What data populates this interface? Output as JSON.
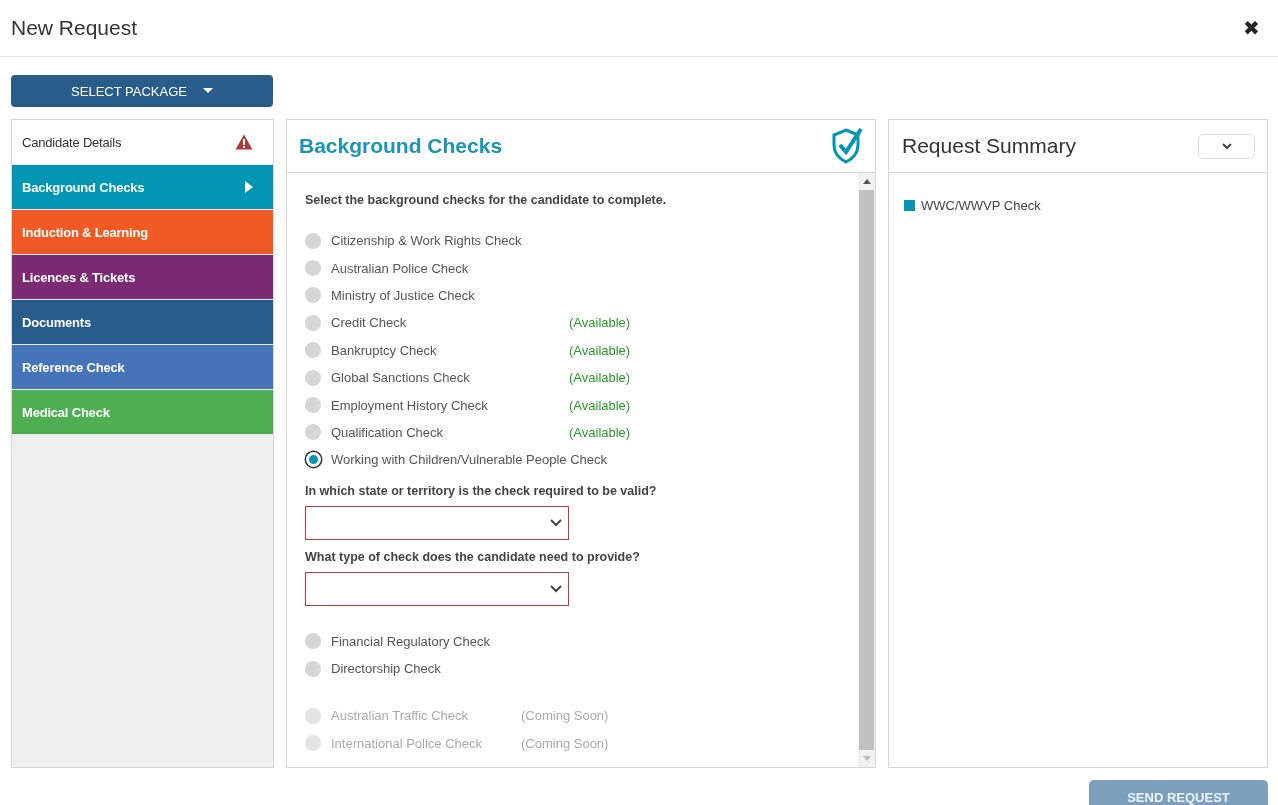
{
  "dialog": {
    "title": "New Request",
    "close": "✖"
  },
  "package_button": {
    "label": "SELECT PACKAGE"
  },
  "sidebar": {
    "items": [
      {
        "label": "Candidate Details",
        "color": "#ffffff",
        "selected": false,
        "warning": true
      },
      {
        "label": "Background Checks",
        "color": "#0096b4",
        "selected": true,
        "warning": false
      },
      {
        "label": "Induction & Learning",
        "color": "#f15a24",
        "selected": false,
        "warning": false
      },
      {
        "label": "Licences & Tickets",
        "color": "#7b2b74",
        "selected": false,
        "warning": false
      },
      {
        "label": "Documents",
        "color": "#285c8a",
        "selected": false,
        "warning": false
      },
      {
        "label": "Reference Check",
        "color": "#4575b8",
        "selected": false,
        "warning": false
      },
      {
        "label": "Medical Check",
        "color": "#4fae52",
        "selected": false,
        "warning": false
      }
    ]
  },
  "checks_panel": {
    "title": "Background Checks",
    "intro": "Select the background checks for the candidate to complete.",
    "sections": [
      {
        "kind": "options",
        "items": [
          {
            "label": "Citizenship & Work Rights Check",
            "selected": false,
            "disabled": false
          },
          {
            "label": "Australian Police Check",
            "selected": false,
            "disabled": false
          },
          {
            "label": "Ministry of Justice Check",
            "selected": false,
            "disabled": false
          },
          {
            "label": "Credit Check",
            "selected": false,
            "disabled": false,
            "status": "(Available)"
          },
          {
            "label": "Bankruptcy Check",
            "selected": false,
            "disabled": false,
            "status": "(Available)"
          },
          {
            "label": "Global Sanctions Check",
            "selected": false,
            "disabled": false,
            "status": "(Available)"
          },
          {
            "label": "Employment History Check",
            "selected": false,
            "disabled": false,
            "status": "(Available)"
          },
          {
            "label": "Qualification Check",
            "selected": false,
            "disabled": false,
            "status": "(Available)"
          },
          {
            "label": "Working with Children/Vulnerable People Check",
            "selected": true,
            "disabled": false
          }
        ]
      },
      {
        "kind": "question",
        "label": "In which state or territory is the check required to be valid?",
        "invalid": true
      },
      {
        "kind": "question",
        "label": "What type of check does the candidate need to provide?",
        "invalid": true
      },
      {
        "kind": "options",
        "items": [
          {
            "label": "Financial Regulatory Check",
            "selected": false,
            "disabled": false
          },
          {
            "label": "Directorship Check",
            "selected": false,
            "disabled": false
          }
        ]
      },
      {
        "kind": "options",
        "items": [
          {
            "label": "Australian Traffic Check",
            "selected": false,
            "disabled": true,
            "status": "(Coming Soon)"
          },
          {
            "label": "International Police Check",
            "selected": false,
            "disabled": true,
            "status": "(Coming Soon)"
          }
        ]
      }
    ]
  },
  "summary_panel": {
    "title": "Request Summary",
    "items": [
      {
        "label": "WWC/WWVP Check",
        "color": "#0096b4"
      }
    ]
  },
  "send_button": {
    "label": "SEND REQUEST",
    "disabled": true
  }
}
